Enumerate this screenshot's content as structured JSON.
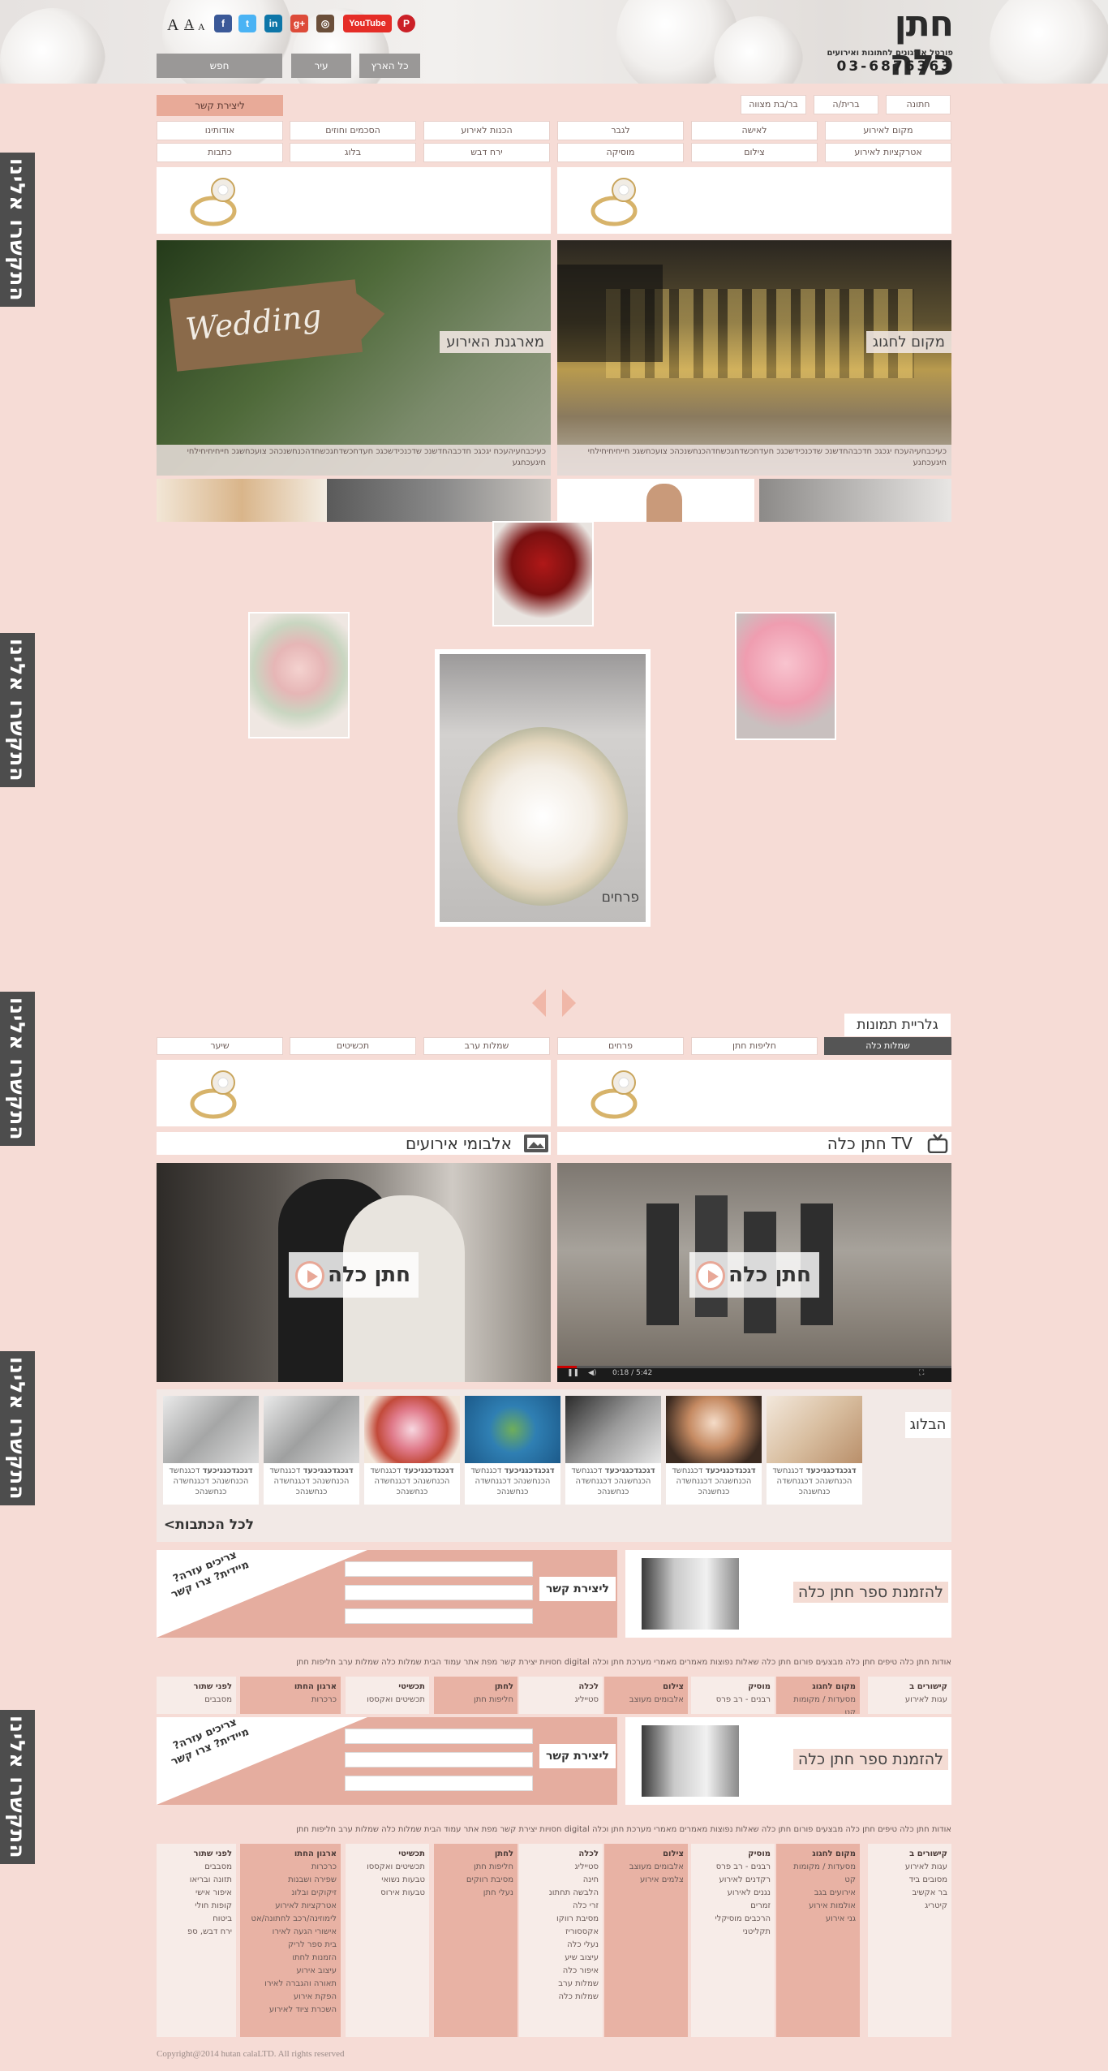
{
  "header": {
    "logo_title": "חתן כלה",
    "logo_subtitle": "פורטל אירגונים לחתונות ואירועים",
    "phone": "03-6876363",
    "font_sizes": [
      "A",
      "A",
      "A"
    ],
    "social": [
      {
        "label": "P",
        "icon": "pinterest-icon",
        "color": "#cb2027"
      },
      {
        "label": "YouTube",
        "icon": "youtube-icon",
        "color": "#e52d27"
      },
      {
        "label": "◎",
        "icon": "instagram-icon",
        "color": "#6b4f3a"
      },
      {
        "label": "g+",
        "icon": "google-plus-icon",
        "color": "#dd4b39"
      },
      {
        "label": "in",
        "icon": "linkedin-icon",
        "color": "#0e76a8"
      },
      {
        "label": "t",
        "icon": "twitter-icon",
        "color": "#4ab3f4"
      },
      {
        "label": "f",
        "icon": "facebook-icon",
        "color": "#3b5998"
      }
    ],
    "search_all": "כל הארץ",
    "search_city": "עיר",
    "search_go": "חפש"
  },
  "nav": {
    "contact": "ליצירת קשר",
    "row1": [
      "חתונה",
      "ברית/ה",
      "בר/בת מצווה"
    ],
    "row2": [
      "מקום לאירוע",
      "לאישה",
      "לגבר",
      "הכנות לאירוע",
      "הסכמים וחוזים",
      "אודותינו"
    ],
    "row3": [
      "אטרקציות לאירוע",
      "צילום",
      "מוסיקה",
      "ירח דבש",
      "בלוג",
      "כתבות"
    ]
  },
  "side_tab": "התקשרו אלינו",
  "promos": [
    {
      "label": "מקום לחגוג",
      "text": "כעיכבחעיהעכח יגכגכ חדכבהחדשנכ שדכנכידשכגכ חעדחכשדחגכשחדהכנחשנכהכ צועכחשגכ חייחיחיחילחי חיגעכחגע"
    },
    {
      "label": "מארגנת האירוע",
      "text": "כעיכבחעיהעכח יגכגכ חדכבהחדשנכ שדכנכידשכגכ חעדחכשדחגכשחדהכנחשנכהכ צועכחשגכ חייחיחיחילחי חיגעכחגע"
    }
  ],
  "gallery": {
    "title": "גלריית תמונות",
    "featured_label": "פרחים",
    "tabs": [
      "שמלות כלה",
      "חליפות חתן",
      "פרחים",
      "שמלות ערב",
      "תכשיטים",
      "שיער"
    ]
  },
  "tv": {
    "title": "חתן כלה TV",
    "badge": "חתן כלה",
    "time": "0:18 / 5:42"
  },
  "albums": {
    "title": "אלבומי אירועים",
    "badge": "חתן כלה"
  },
  "blog": {
    "title": "הבלוג",
    "items": [
      {
        "bold": "דגכגדכגניכעד",
        "text": "דכגנחשד הכנחשנהכ דכגנחשדה כנחשנהכ"
      },
      {
        "bold": "דגכגדכגניכעד",
        "text": "דכגנחשד הכנחשנהכ דכגנחשדה כנחשנהכ"
      },
      {
        "bold": "דגכגדכגניכעד",
        "text": "דכגנחשד הכנחשנהכ דכגנחשדה כנחשנהכ"
      },
      {
        "bold": "דגכגדכגניכעד",
        "text": "דכגנחשד הכנחשנהכ דכגנחשדה כנחשנהכ"
      },
      {
        "bold": "דגכגדכגניכעד",
        "text": "דכגנחשד הכנחשנהכ דכגנחשדה כנחשנהכ"
      },
      {
        "bold": "דגכגדכגניכעד",
        "text": "דכגנחשד הכנחשנהכ דכגנחשדה כנחשנהכ"
      },
      {
        "bold": "דגכגדכגניכעד",
        "text": "דכגנחשד הכנחשנהכ דכגנחשדה כנחשנהכ"
      }
    ],
    "more": "לכל הכתבות>"
  },
  "form": {
    "help": "צריכים עזרה? מיידית? צרו קשר",
    "submit": "ליצירת קשר",
    "book": "להזמנת ספר חתן כלה"
  },
  "footer": {
    "links": "אודות חתן כלה   טיפים חתן כלה   מבצעים   פורום חתן כלה   שאלות נפוצות   מאמרים   מאמרי מערכת   חתן וכלה digital   חסויות   יצירת קשר   מפת אתר   עמוד הבית   שמלות כלה   שמלות ערב   חליפות חתן",
    "columns_short": [
      {
        "title": "קישורים ב",
        "items": [
          "עגות לאירוע"
        ]
      },
      {
        "title": "מקום לחגוג",
        "items": [
          "מסעדות / מקומות קט"
        ]
      },
      {
        "title": "מוסיק",
        "items": [
          "רבנים - רב פרס"
        ]
      },
      {
        "title": "צילום",
        "items": [
          "אלבומים מעוצב"
        ]
      },
      {
        "title": "לכלה",
        "items": [
          "סטייליג"
        ]
      },
      {
        "title": "לחתן",
        "items": [
          "חליפות חתן"
        ]
      },
      {
        "title": "תכשיטי",
        "items": [
          "תכשיטים ואקססו"
        ]
      },
      {
        "title": "ארגון החתו",
        "items": [
          "כרכרות"
        ]
      },
      {
        "title": "לפני שתור",
        "items": [
          "מסבבים"
        ]
      }
    ],
    "columns_full": [
      {
        "title": "קישורים ב",
        "items": [
          "עגות לאירוע",
          "מסובים ביד",
          "בר אקשיב",
          "קיטריג"
        ]
      },
      {
        "title": "מקום לחגוג",
        "items": [
          "מסעדות / מקומות קט",
          "אירועים בגב",
          "אולמות אירוע",
          "גני אירוע"
        ]
      },
      {
        "title": "מוסיק",
        "items": [
          "רבנים - רב פרס",
          "רקדנים לאירוע",
          "נגנים לאירוע",
          "זמרים",
          "הרכבים מוסיקלי",
          "תקליטני"
        ]
      },
      {
        "title": "צילום",
        "items": [
          "אלבומים מעוצב",
          "צלמים אירוע"
        ]
      },
      {
        "title": "לכלה",
        "items": [
          "סטייליג",
          "חינה",
          "הלבשה תחתונ",
          "זרי כלה",
          "מסיבת רווקו",
          "אקססוריז",
          "נעלי כלה",
          "עיצוב שיע",
          "איפור כלה",
          "שמלות ערב",
          "שמלות כלה"
        ]
      },
      {
        "title": "לחתן",
        "items": [
          "חליפות חתן",
          "מסיבת רווקים",
          "נעלי חתן"
        ]
      },
      {
        "title": "תכשיטי",
        "items": [
          "תכשיטים ואקססו",
          "טבעות נשואי",
          "טבעות אירוס"
        ]
      },
      {
        "title": "ארגון החתו",
        "items": [
          "כרכרות",
          "שפירה ושבנות",
          "זיקוקים ובלונ",
          "אטרקציות לאירוע",
          "לימוזינה/רכב לחתונה/אט",
          "אישורי הגעה לאירו",
          "בית ספר לריק",
          "הזמנות לחתו",
          "עיצוב אירוע",
          "תאורה והגברה לאירו",
          "הפקת אירוע",
          "השכרת ציוד לאירוע"
        ]
      },
      {
        "title": "לפני שתור",
        "items": [
          "מסבבים",
          "תזונה ובריאו",
          "איפור אישי",
          "קופות חולי",
          "ביטוח",
          "ירח דבש, ספ"
        ]
      }
    ]
  },
  "copyright": "Copyright@2014 hutan calaLTD. All rights reserved"
}
